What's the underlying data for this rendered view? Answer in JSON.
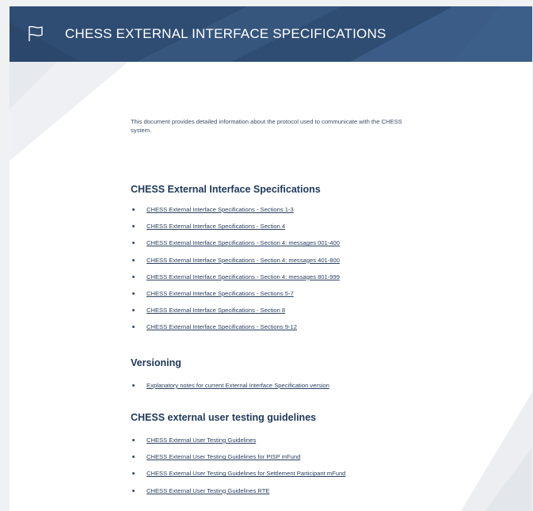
{
  "header": {
    "title": "CHESS EXTERNAL INTERFACE SPECIFICATIONS",
    "icon": "flag-icon"
  },
  "intro": "This document provides detailed information about the protocol used to communicate with the CHESS system.",
  "sections": [
    {
      "heading": "CHESS External Interface Specifications",
      "links": [
        "CHESS External Interface Specifications - Sections 1-3",
        "CHESS External Interface Specifications - Section 4",
        "CHESS External Interface Specifications - Section 4: messages 001-400",
        "CHESS External Interface Specifications - Section 4: messages 401-800",
        "CHESS External Interface Specifications - Section 4: messages 801-999",
        "CHESS External Interface Specifications - Sections 5-7",
        "CHESS External Interface Specifications - Section 8",
        "CHESS External Interface Specifications - Sections 9-12"
      ]
    },
    {
      "heading": "Versioning",
      "links": [
        "Explanatory notes for current External Interface Specification version"
      ]
    },
    {
      "heading": "CHESS external user testing guidelines",
      "links": [
        "CHESS External User Testing Guidelines",
        "CHESS External User Testing Guidelines for PISP mFund",
        "CHESS External User Testing Guidelines for Settlement Participant mFund",
        "CHESS External User Testing Guidelines RTE"
      ]
    }
  ],
  "colors": {
    "header_bg": "#2f4d73",
    "header_text": "#ffffff",
    "heading": "#213a5a",
    "link": "#2a3f5e"
  }
}
